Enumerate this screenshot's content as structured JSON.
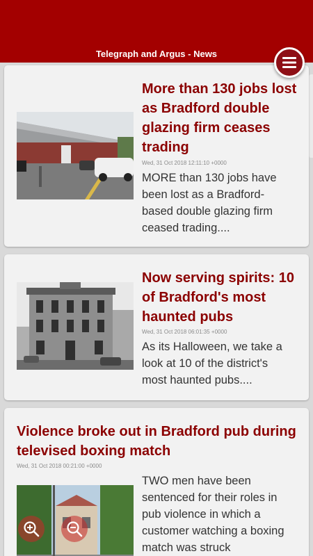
{
  "header": {
    "title": "Telegraph and Argus - News",
    "color": "#a30000"
  },
  "menu": {
    "icon": "hamburger-menu-icon"
  },
  "articles": [
    {
      "headline": "More than 130 jobs lost as Bradford double glazing firm ceases trading",
      "date": "Wed, 31 Oct 2018 12:11:10 +0000",
      "summary": "MORE than 130 jobs have been lost as a Bradford-based double glazing firm ceased trading...."
    },
    {
      "headline": "Now serving spirits: 10 of Bradford's most haunted pubs",
      "date": "Wed, 31 Oct 2018 06:01:35 +0000",
      "summary": "As its Halloween, we take a look at 10 of the district's most haunted pubs...."
    },
    {
      "headline": "Violence broke out in Bradford pub during televised boxing match",
      "date": "Wed, 31 Oct 2018 00:21:00 +0000",
      "summary": "TWO men have been sentenced for their roles in pub violence in which a customer watching a boxing match was struck"
    }
  ],
  "zoom": {
    "in_icon": "zoom-in-icon",
    "out_icon": "zoom-out-icon"
  }
}
